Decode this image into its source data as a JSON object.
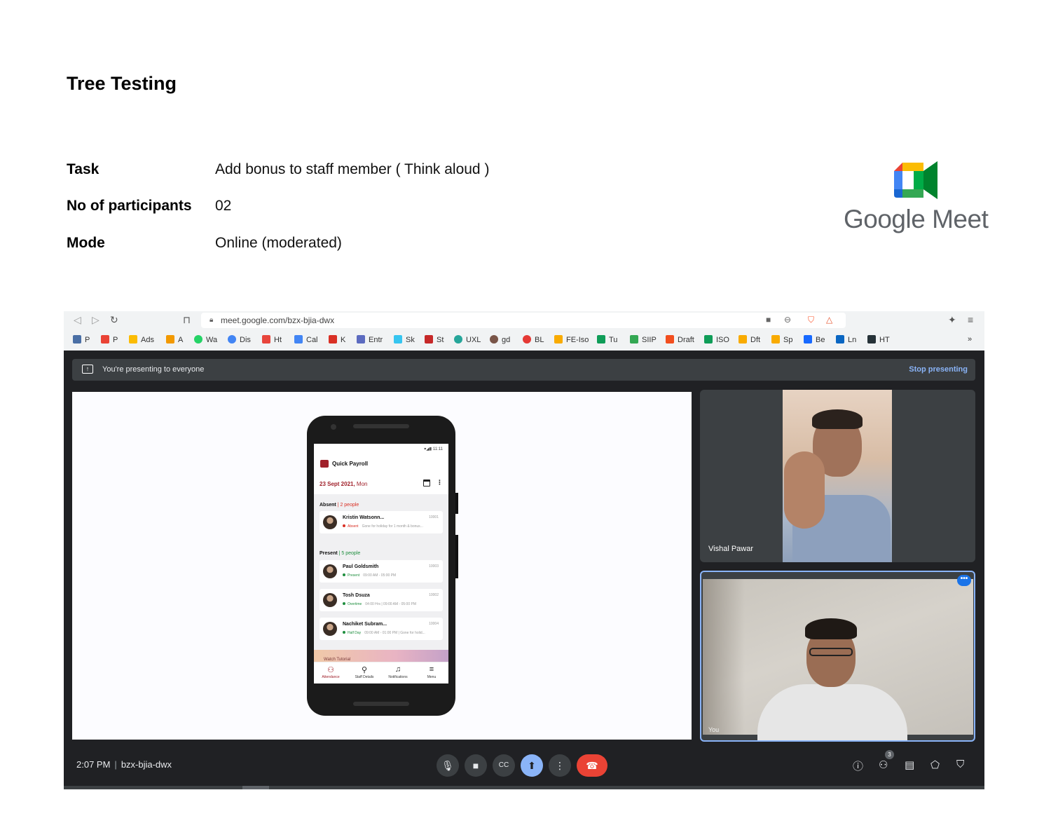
{
  "slide": {
    "title": "Tree Testing",
    "details": [
      {
        "label": "Task",
        "value": "Add bonus to staff member ( Think aloud )"
      },
      {
        "label": "No of participants",
        "value": "02"
      },
      {
        "label": "Mode",
        "value": "Online (moderated)"
      }
    ],
    "logo_text": "Google Meet"
  },
  "browser": {
    "url": "meet.google.com/bzx-bjia-dwx",
    "bookmarks": [
      {
        "label": "P",
        "color": "#4a6fa5"
      },
      {
        "label": "P",
        "color": "#ea4335"
      },
      {
        "label": "Ads",
        "color": "#fbbc04"
      },
      {
        "label": "A",
        "color": "#f29900"
      },
      {
        "label": "Wa",
        "color": "#25d366"
      },
      {
        "label": "Dis",
        "color": "#4285f4"
      },
      {
        "label": "Ht",
        "color": "#e8453c"
      },
      {
        "label": "Cal",
        "color": "#4285f4"
      },
      {
        "label": "K",
        "color": "#d93025"
      },
      {
        "label": "Entr",
        "color": "#5c6bc0"
      },
      {
        "label": "Sk",
        "color": "#36c5f0"
      },
      {
        "label": "St",
        "color": "#c62828"
      },
      {
        "label": "UXL",
        "color": "#26a69a"
      },
      {
        "label": "gd",
        "color": "#795548"
      },
      {
        "label": "BL",
        "color": "#e53935"
      },
      {
        "label": "FE-Iso",
        "color": "#f9ab00"
      },
      {
        "label": "Tu",
        "color": "#0f9d58"
      },
      {
        "label": "SIIP",
        "color": "#34a853"
      },
      {
        "label": "Draft",
        "color": "#f24e1e"
      },
      {
        "label": "ISO",
        "color": "#0f9d58"
      },
      {
        "label": "Dft",
        "color": "#f9ab00"
      },
      {
        "label": "Sp",
        "color": "#f9ab00"
      },
      {
        "label": "Be",
        "color": "#1769ff"
      },
      {
        "label": "Ln",
        "color": "#0a66c2"
      },
      {
        "label": "HT",
        "color": "#263238"
      }
    ]
  },
  "meet": {
    "banner_text": "You're presenting to everyone",
    "stop_label": "Stop presenting",
    "participant_name": "Vishal Pawar",
    "self_label": "You",
    "time": "2:07 PM",
    "meeting_code": "bzx-bjia-dwx",
    "people_count": "3",
    "accent": "#8ab4f8",
    "hangup_color": "#ea4335"
  },
  "app": {
    "status_time": "11:11",
    "title": "Quick Payroll",
    "date_bold": "23 Sept 2021,",
    "date_day": " Mon",
    "absent": {
      "label": "Absent",
      "count": "| 2 people"
    },
    "present": {
      "label": "Present",
      "count": "| 5 people"
    },
    "absent_staff": [
      {
        "name": "Kristin Watsonn...",
        "id": "10001",
        "status": "Absent",
        "status_color": "#d93025",
        "note": "Gone for holiday for 1 month & bonus..."
      }
    ],
    "present_staff": [
      {
        "name": "Paul Goldsmith",
        "id": "10003",
        "status": "Present",
        "status_color": "#1e8e3e",
        "note": "09:00 AM - 05:00 PM"
      },
      {
        "name": "Tosh Dsuza",
        "id": "10002",
        "status": "Overtime",
        "status_color": "#1e8e3e",
        "note": "04:00 Hrs  |  09:00 AM - 05:00 PM"
      },
      {
        "name": "Nachiket Subram...",
        "id": "10004",
        "status": "Half Day",
        "status_color": "#1e8e3e",
        "note": "09:00 AM - 01:00 PM | Gone for holid..."
      }
    ],
    "tutorial": "Watch Tutorial",
    "nav": [
      "Attendance",
      "Staff Details",
      "Notifications",
      "Menu"
    ],
    "brand_color": "#a0202a"
  }
}
